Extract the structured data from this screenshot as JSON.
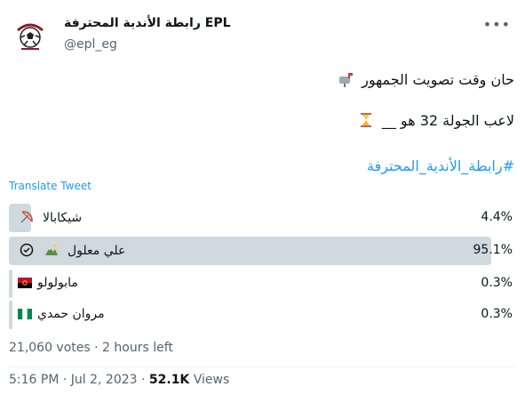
{
  "account": {
    "name": "رابطة الأندية المحترفة EPL",
    "handle": "@epl_eg",
    "more_icon": "more-icon"
  },
  "tweet": {
    "line1": "حان وقت تصويت الجمهور",
    "line2": "لاعب الجولة 32 هو __",
    "hashtag": "#رابطة_الأندية_المحترفة"
  },
  "translate_label": "Translate Tweet",
  "poll": {
    "options": [
      {
        "label": "شيكابالا",
        "percent_text": "4.4%",
        "fraction": 0.044
      },
      {
        "label": "علي معلول",
        "percent_text": "95.1%",
        "fraction": 0.951,
        "selected": true
      },
      {
        "label": "مابولولو",
        "percent_text": "0.3%",
        "fraction": 0.003
      },
      {
        "label": "مروان حمدي",
        "percent_text": "0.3%",
        "fraction": 0.003
      }
    ],
    "summary": "21,060 votes · 2 hours left"
  },
  "footer": {
    "datetime": "5:16 PM · Jul 2, 2023 · ",
    "views_count": "52.1K",
    "views_label": " Views"
  },
  "colors": {
    "link": "#1d9bf0",
    "poll_bar": "#cfd9de",
    "muted": "#536471"
  }
}
